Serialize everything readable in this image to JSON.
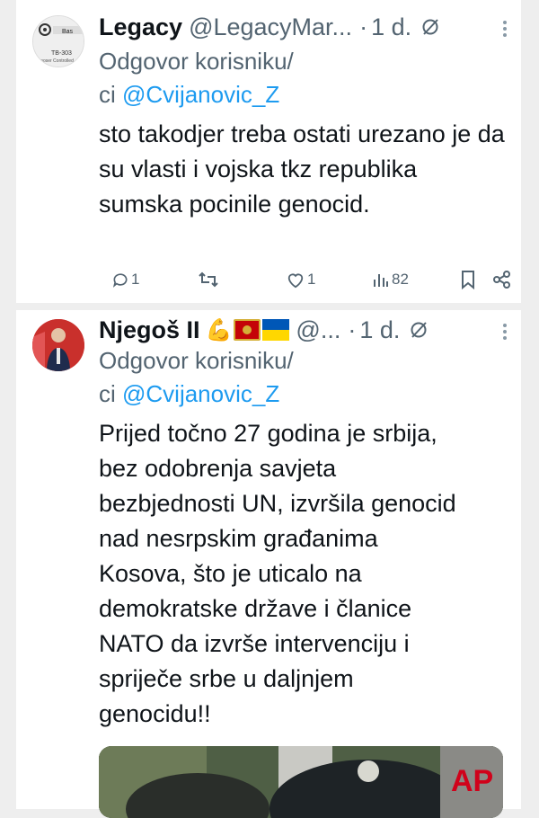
{
  "tweets": [
    {
      "display_name": "Legacy",
      "handle": "@LegacyMar...",
      "separator": "·",
      "time": "1 d.",
      "reply_prefix": "Odgovor korisniku/",
      "reply_suffix_prefix": "ci ",
      "reply_mention": "@Cvijanovic_Z",
      "body": "sto takodjer treba ostati urezano je da su vlasti i vojska tkz republika sumska pocinile genocid.",
      "avatar_text_1": "TB-303",
      "avatar_text_2": "mposer Controlled",
      "avatar_text_3": "Bas",
      "actions": {
        "replies": "1",
        "retweets": "",
        "likes": "1",
        "views": "82"
      }
    },
    {
      "display_name": "Njegoš II",
      "handle": "@...",
      "separator": "·",
      "time": "1 d.",
      "reply_prefix": "Odgovor korisniku/",
      "reply_suffix_prefix": "ci ",
      "reply_mention": "@Cvijanovic_Z",
      "body_lines": [
        "Prijed točno 27 godina je srbija,",
        "bez odobrenja savjeta",
        "bezbjednosti UN, izvršila genocid",
        "nad nesrpskim građanima",
        "Kosova, što je uticalo na",
        "demokratske države i članice",
        "NATO da izvrše intervenciju i",
        "spriječe srbe u daljnjem",
        "genocidu!!"
      ],
      "emoji_flex": "💪",
      "media_watermark": "AP"
    }
  ],
  "icons": [
    "more-vertical-icon",
    "grok-icon",
    "reply-icon",
    "retweet-icon",
    "like-icon",
    "views-icon",
    "bookmark-icon",
    "share-icon",
    "flexed-biceps-icon",
    "montenegro-flag-icon",
    "ukraine-flag-icon"
  ],
  "colors": {
    "link": "#1d9bf0",
    "secondary": "#536471",
    "text": "#0f1419"
  }
}
